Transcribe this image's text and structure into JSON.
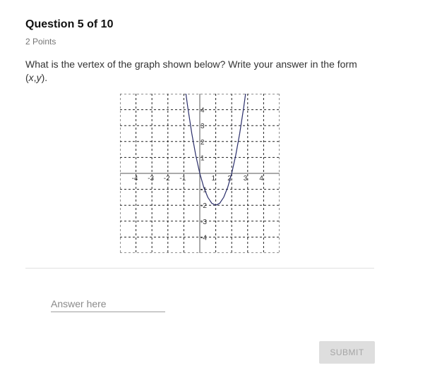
{
  "question": {
    "title": "Question 5 of 10",
    "points": "2 Points",
    "text_before": "What is the vertex of the graph shown below? Write your answer in the form (",
    "text_x": "x",
    "text_comma": ",",
    "text_y": "y",
    "text_after": ")."
  },
  "answer": {
    "placeholder": "Answer here",
    "value": ""
  },
  "submit": {
    "label": "SUBMIT"
  },
  "colors": {
    "curve": "#2b2f6b",
    "grid": "#222222",
    "button_bg": "#dedede",
    "button_text": "#a5a5a5"
  },
  "chart_data": {
    "type": "line",
    "xlim": [
      -5,
      5
    ],
    "ylim": [
      -5,
      5
    ],
    "grid": true,
    "grid_style": "dashed",
    "x_ticks": [
      {
        "value": -4,
        "label": "-4"
      },
      {
        "value": -3,
        "label": "-3"
      },
      {
        "value": -2,
        "label": "-2"
      },
      {
        "value": -1,
        "label": "-1"
      },
      {
        "value": 1,
        "label": "1"
      },
      {
        "value": 2,
        "label": "2"
      },
      {
        "value": 3,
        "label": "3"
      },
      {
        "value": 4,
        "label": "4"
      }
    ],
    "y_ticks": [
      {
        "value": 4,
        "label": "4"
      },
      {
        "value": 3,
        "label": "3"
      },
      {
        "value": 2,
        "label": "2"
      },
      {
        "value": 1,
        "label": "1"
      },
      {
        "value": -1,
        "label": "-1"
      },
      {
        "value": -2,
        "label": "-2"
      },
      {
        "value": -3,
        "label": "-3"
      },
      {
        "value": -4,
        "label": "-4"
      }
    ],
    "series": [
      {
        "function": "y = 2x^2 - 4x",
        "x": [
          -0.9,
          -0.75,
          -0.5,
          -0.25,
          0,
          0.25,
          0.5,
          0.75,
          1,
          1.25,
          1.5,
          1.75,
          2,
          2.25,
          2.5,
          2.75,
          2.9
        ],
        "y": [
          5.22,
          4.125,
          2.5,
          1.125,
          0,
          -0.875,
          -1.5,
          -1.875,
          -2,
          -1.875,
          -1.5,
          -0.875,
          0,
          1.125,
          2.5,
          4.125,
          5.22
        ]
      }
    ]
  }
}
